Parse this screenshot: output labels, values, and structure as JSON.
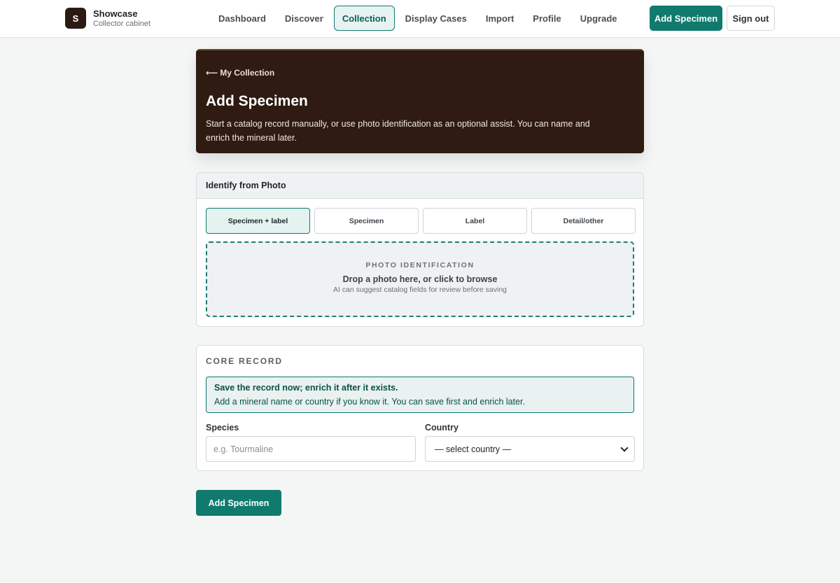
{
  "brand": {
    "logo_letter": "S",
    "name": "Showcase",
    "subtitle": "Collector cabinet"
  },
  "nav": {
    "items": [
      {
        "label": "Dashboard",
        "active": false
      },
      {
        "label": "Discover",
        "active": false
      },
      {
        "label": "Collection",
        "active": true
      },
      {
        "label": "Display Cases",
        "active": false
      },
      {
        "label": "Import",
        "active": false
      },
      {
        "label": "Profile",
        "active": false
      },
      {
        "label": "Upgrade",
        "active": false
      }
    ],
    "primary_action": "Add Specimen",
    "sign_out": "Sign out"
  },
  "hero": {
    "back_arrow": "⟵",
    "back_label": "My Collection",
    "title": "Add Specimen",
    "description": "Start a catalog record manually, or use photo identification as an optional assist. You can name and enrich the mineral later."
  },
  "photo_card": {
    "title": "Identify from Photo",
    "modes": [
      {
        "label": "Specimen + label",
        "selected": true
      },
      {
        "label": "Specimen",
        "selected": false
      },
      {
        "label": "Label",
        "selected": false
      },
      {
        "label": "Detail/other",
        "selected": false
      }
    ],
    "dropzone": {
      "eyebrow": "PHOTO IDENTIFICATION",
      "main": "Drop a photo here, or click to browse",
      "sub": "AI can suggest catalog fields for review before saving"
    }
  },
  "core": {
    "title": "CORE RECORD",
    "notice_title": "Save the record now; enrich it after it exists.",
    "notice_body": "Add a mineral name or country if you know it. You can save first and enrich later.",
    "species_label": "Species",
    "species_placeholder": "e.g. Tourmaline",
    "species_value": "",
    "country_label": "Country",
    "country_selected": "— select country —"
  },
  "submit_label": "Add Specimen",
  "colors": {
    "accent": "#0f7a6d",
    "hero_bg": "#2f1b12",
    "brand_logo_bg": "#2c1a12"
  }
}
